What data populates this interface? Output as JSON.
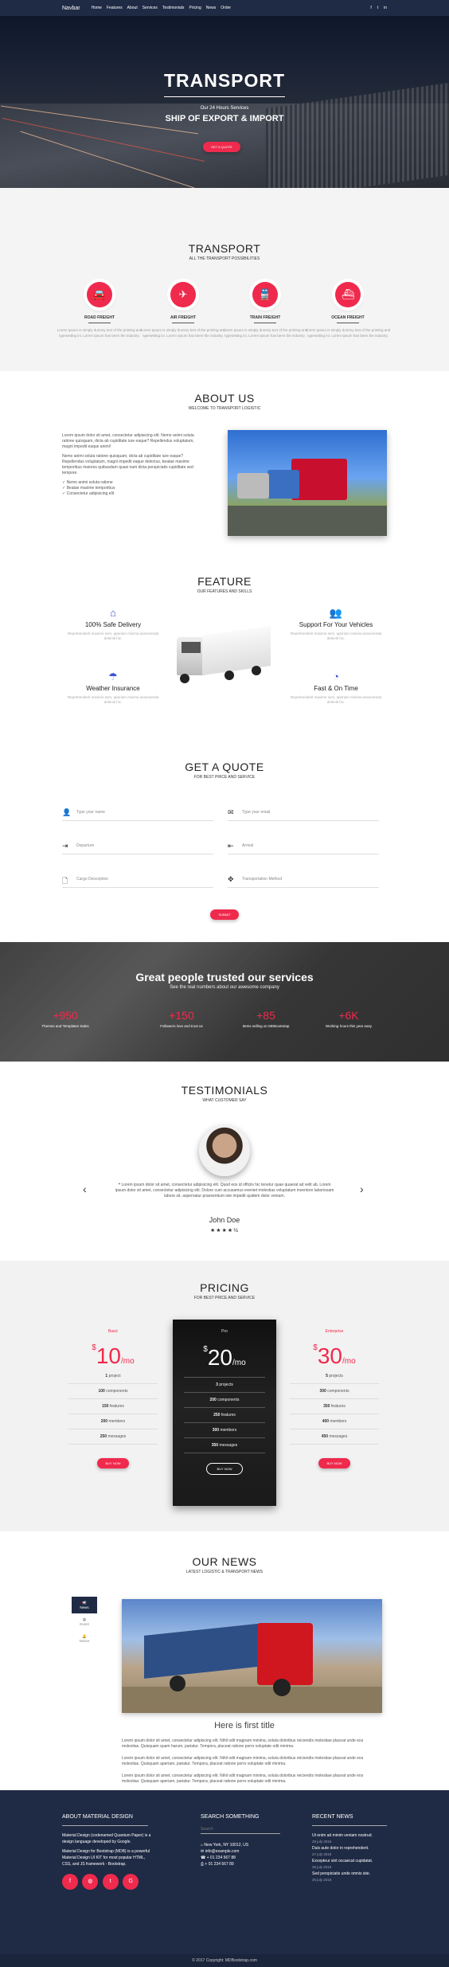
{
  "nav": {
    "brand": "Navbar",
    "links": [
      "Home",
      "Features",
      "About",
      "Services",
      "Testimonials",
      "Pricing",
      "News",
      "Order"
    ],
    "social": [
      "f",
      "t",
      "in"
    ]
  },
  "hero": {
    "title": "TRANSPORT",
    "subtitle": "Our 24 Hours Services",
    "tagline": "SHIP OF EXPORT & IMPORT",
    "button": "GET A QUOTE"
  },
  "transport": {
    "title": "TRANSPORT",
    "subtitle": "ALL THE TRANSPORT POSSIBILITIES",
    "services": [
      {
        "name": "ROAD FREIGHT",
        "icon": "car-icon",
        "desc": "Lorem Ipsum is simply dummy text of the printing and typesetting ini. Lorem Ipsum has been the industry."
      },
      {
        "name": "AIR FREIGHT",
        "icon": "plane-icon",
        "desc": "Lorem Ipsum is simply dummy text of the printing and typesetting ini. Lorem Ipsum has been the industry."
      },
      {
        "name": "TRAIN FREIGHT",
        "icon": "train-icon",
        "desc": "Lorem Ipsum is simply dummy text of the printing and typesetting ini. Lorem Ipsum has been the industry."
      },
      {
        "name": "OCEAN FREIGHT",
        "icon": "ship-icon",
        "desc": "Lorem Ipsum is simply dummy text of the printing and typesetting ini. Lorem Ipsum has been the industry."
      }
    ]
  },
  "about": {
    "title": "ABOUT US",
    "subtitle": "WELCOME TO TRANSPORT LOGISTIC",
    "p1": "Lorem ipsum dolor sit amet, consectetur adipisicing elit. Nemo animi soluta ratione quisquam, dicta ab cupiditate iure eaque? Repellendus voluptatum, magni impedit eaque animi!",
    "p2": "Nemo animi soluta ratione quisquam, dicta ab cupiditate iure eaque? Repellendus voluptatum, magni impedit eaque delectus, beatae maxime temporibus maiores quibusdam quasi nam dicta perspiciatis cupiditate sed tempore.",
    "list": [
      "Nemo animi soluta ratione",
      "Beatae maxime temporibus",
      "Consectetur adipisicing elit"
    ]
  },
  "feature": {
    "title": "FEATURE",
    "subtitle": "OUR FEATURES AND SKILLS",
    "items": [
      {
        "name": "100% Safe Delivery",
        "icon": "home-icon",
        "desc": "Reprehenderit maxime sem, aperiam minima assumenda deleniti hic."
      },
      {
        "name": "Support For Your Vehicles",
        "icon": "users-icon",
        "desc": "Reprehenderit maxime sem, aperiam minima assumenda deleniti hic."
      },
      {
        "name": "Weather Insurance",
        "icon": "umbrella-icon",
        "desc": "Reprehenderit maxime sem, aperiam minima assumenda deleniti hic."
      },
      {
        "name": "Fast & On Time",
        "icon": "dashboard-icon",
        "desc": "Reprehenderit maxime sem, aperiam minima assumenda deleniti hic."
      }
    ]
  },
  "quote": {
    "title": "GET A QUOTE",
    "subtitle": "FOR BEST PRICE AND SERVICE",
    "fields": [
      "Type your name",
      "Type your email",
      "Departure",
      "Arrival",
      "Cargo Description",
      "Transportation Method"
    ],
    "button": "SUBMIT"
  },
  "trusted": {
    "title": "Great people trusted our services",
    "subtitle": "See the real numbers about our awesome company",
    "stats": [
      {
        "num": "+950",
        "label": "Themes and Templates Sales"
      },
      {
        "num": "+150",
        "label": "Followers love and trust us"
      },
      {
        "num": "+85",
        "label": "Items selling on MDBootstrap"
      },
      {
        "num": "+6K",
        "label": "Working hours this year easy"
      }
    ]
  },
  "testimonials": {
    "title": "TESTIMONIALS",
    "subtitle": "WHAT CUSTOMER SAY",
    "quote": "Lorem ipsum dolor sit amet, consectetur adipisicing elit. Quod eos id officiis hic tenetur quae quaerat ad velit ab. Lorem ipsum dolor sit amet, consectetur adipisicing elit. Dolore cum accusamus eveniet molestias voluptatum inventore laboriosam labore sit, aspernatur praesentium iste impedit quidem dolor veniam.",
    "name": "John Doe",
    "stars": "★★★★½"
  },
  "pricing": {
    "title": "PRICING",
    "subtitle": "FOR BEST PRICE AND SERVICE",
    "plans": [
      {
        "name": "Basic",
        "price": "10",
        "rows": [
          [
            "1",
            "project"
          ],
          [
            "100",
            "components"
          ],
          [
            "150",
            "features"
          ],
          [
            "200",
            "members"
          ],
          [
            "250",
            "messages"
          ]
        ],
        "button": "BUY NOW"
      },
      {
        "name": "Pro",
        "price": "20",
        "rows": [
          [
            "3",
            "projects"
          ],
          [
            "200",
            "components"
          ],
          [
            "250",
            "features"
          ],
          [
            "300",
            "members"
          ],
          [
            "350",
            "messages"
          ]
        ],
        "button": "BUY NOW"
      },
      {
        "name": "Enterprise",
        "price": "30",
        "rows": [
          [
            "5",
            "projects"
          ],
          [
            "300",
            "components"
          ],
          [
            "350",
            "features"
          ],
          [
            "400",
            "members"
          ],
          [
            "450",
            "messages"
          ]
        ],
        "button": "BUY NOW"
      }
    ],
    "currency": "$",
    "per": "/mo"
  },
  "news": {
    "title": "OUR NEWS",
    "subtitle": "LATEST LOGISTIC & TRANSPORT NEWS",
    "tabs": [
      "News",
      "Event",
      "Notice"
    ],
    "post_title": "Here is first title",
    "p1": "Lorem ipsum dolor sit amet, consectetur adipiscing elit. Nihil odit magnam minima, soluta doloribus reiciendis molestiae placeat unde eos molestias. Quisquam quam harum, pariatur. Tempora, placeat ratione porro voluptate odit minima.",
    "p2": "Lorem ipsum dolor sit amet, consectetur adipiscing elit. Nihil odit magnam minima, soluta doloribus reiciendis molestiae placeat unde eos molestias. Quisquam aperiam, pariatur. Tempora, placeat ratione porro voluptate odit minima.",
    "p3": "Lorem ipsum dolor sit amet, consectetur adipiscing elit. Nihil odit magnam minima, soluta doloribus reiciendis molestiae placeat unde eos molestias. Quisquam aperiam, pariatur. Tempora, placeat ratione porro voluptate odit minima."
  },
  "footer": {
    "about_title": "ABOUT MATERIAL DESIGN",
    "about_p1": "Material Design (codenamed Quantum Paper) is a design language developed by Google.",
    "about_p2": "Material Design for Bootstrap (MDB) is a powerful Material Design UI KIT for most popular HTML, CSS, and JS framework - Bootstrap.",
    "search_title": "SEARCH SOMETHING",
    "search_placeholder": "Search",
    "address": "New York, NY 10012, US",
    "email": "info@example.com",
    "phone1": "+ 01 234 567 88",
    "phone2": "+ 01 234 567 89",
    "recent_title": "RECENT NEWS",
    "recent": [
      {
        "t": "Ut enim ad minim veniam nostrud.",
        "d": "28 july 2016"
      },
      {
        "t": "Duis aute dolor in reprehenderit.",
        "d": "27 july 2016"
      },
      {
        "t": "Excepteur sint occaecat cupidatat.",
        "d": "26 july 2016"
      },
      {
        "t": "Sed perspiciatis unde omnis iste.",
        "d": "25 july 2016"
      }
    ],
    "copyright": "© 2017 Copyright: MDBootstrap.com",
    "colors": {
      "accent": "#ef2a4d",
      "navy": "#1f2a44"
    }
  }
}
